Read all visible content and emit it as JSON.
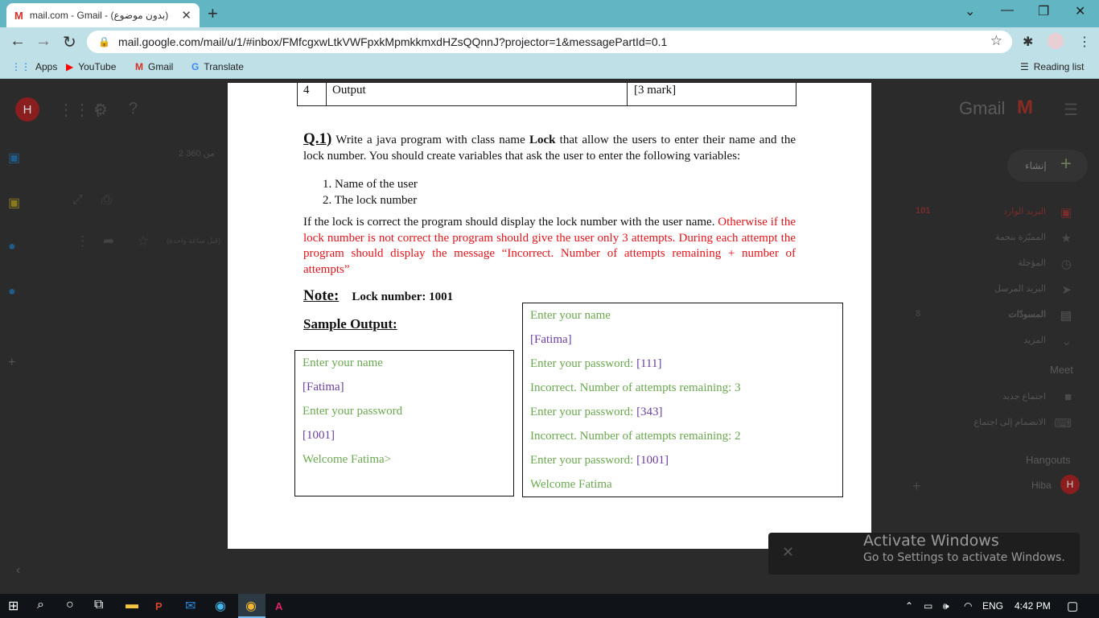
{
  "browser": {
    "tab_title": "mail.com - Gmail - (بدون موضوع)",
    "tab_icon": "gmail-m-icon",
    "url": "mail.google.com/mail/u/1/#inbox/FMfcgxwLtkVWFpxkMpmkkmxdHZsQQnnJ?projector=1&messagePartId=0.1"
  },
  "bookmarks": [
    {
      "label": "Apps",
      "icon": "apps-grid-icon"
    },
    {
      "label": "YouTube",
      "icon": "youtube-icon"
    },
    {
      "label": "Gmail",
      "icon": "gmail-icon"
    },
    {
      "label": "Translate",
      "icon": "translate-icon"
    }
  ],
  "reading_list": "Reading list",
  "gmail": {
    "logo_text": "Gmail",
    "avatar_letter": "H",
    "compose_label": "إنشاء",
    "pagination": "2 من 360",
    "inbox_count": "101",
    "drafts_count": "8",
    "sidebar": [
      {
        "label": "البريد الوارد",
        "icon": "inbox-icon"
      },
      {
        "label": "المميّزة بنجمة",
        "icon": "star-icon"
      },
      {
        "label": "المؤجلة",
        "icon": "clock-icon"
      },
      {
        "label": "البريد المرسل",
        "icon": "send-icon"
      },
      {
        "label": "المسودّات",
        "icon": "draft-icon"
      },
      {
        "label": "المزيد",
        "icon": "chevron-down-icon"
      }
    ],
    "meet_title": "Meet",
    "meet_items": [
      "اجتماع جديد",
      "الانضمام إلى اجتماع"
    ],
    "hangouts_title": "Hangouts",
    "hangouts_user": "Hiba",
    "time_ago": "(قبل ساعة واحدة)"
  },
  "document": {
    "table_row": {
      "num": "4",
      "item": "Output",
      "mark": "[3 mark]"
    },
    "q_label": "Q.1)",
    "q_text_before": " Write a java program with class name ",
    "q_class": "Lock",
    "q_text_after": " that allow the users to enter their name and the lock number. You should create variables that ask the user to enter the following variables:",
    "list": [
      "1.   Name of the user",
      "2.   The lock number"
    ],
    "para_black": "If the lock is correct the program should display the lock number with the user name. ",
    "para_red": "Otherwise if the lock number is not correct the program should give the user only 3 attempts. During each attempt the program should display the message “Incorrect. Number of attempts remaining + number of attempts”",
    "note_label": "Note:",
    "note_value": "Lock number: 1001",
    "sample_label": "Sample Output:",
    "box1": [
      {
        "text": "Enter your name",
        "param": ""
      },
      {
        "text": " ",
        "param": "[Fatima]"
      },
      {
        "text": "Enter your password",
        "param": ""
      },
      {
        "text": " ",
        "param": "[1001]"
      },
      {
        "text": "Welcome  Fatima>",
        "param": ""
      }
    ],
    "box2": [
      {
        "text": "Enter your name",
        "param": ""
      },
      {
        "text": " ",
        "param": "[Fatima]"
      },
      {
        "text": "Enter your password: ",
        "param": "[111]"
      },
      {
        "text": "Incorrect. Number of attempts remaining: 3",
        "param": ""
      },
      {
        "text": "Enter your password: ",
        "param": "[343]"
      },
      {
        "text": "Incorrect. Number of attempts remaining: 2",
        "param": ""
      },
      {
        "text": "Enter your password:  ",
        "param": "[1001]"
      },
      {
        "text": "Welcome Fatima",
        "param": ""
      }
    ]
  },
  "activate_windows": {
    "title": "Activate Windows",
    "subtitle": "Go to Settings to activate Windows."
  },
  "taskbar": {
    "lang": "ENG",
    "time": "4:42 PM"
  }
}
